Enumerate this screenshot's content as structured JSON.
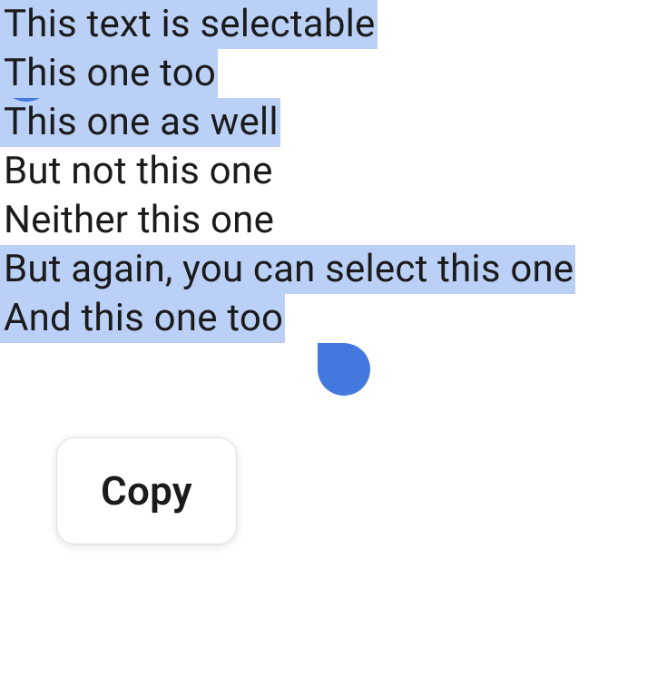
{
  "lines": {
    "l1": {
      "text": "This text is selectable",
      "selected": true
    },
    "l2": {
      "text": "This one too",
      "selected": true
    },
    "l3": {
      "text": "This one as well",
      "selected": true
    },
    "l4": {
      "text": "But not this one",
      "selected": false
    },
    "l5": {
      "text": "Neither this one",
      "selected": false
    },
    "l6": {
      "text": "But again, you can select this one",
      "selected": true
    },
    "l7": {
      "text": "And this one too",
      "selected": true
    }
  },
  "popup": {
    "copy_label": "Copy"
  },
  "colors": {
    "selection_bg": "#bbd0f7",
    "handle": "#4379df"
  }
}
